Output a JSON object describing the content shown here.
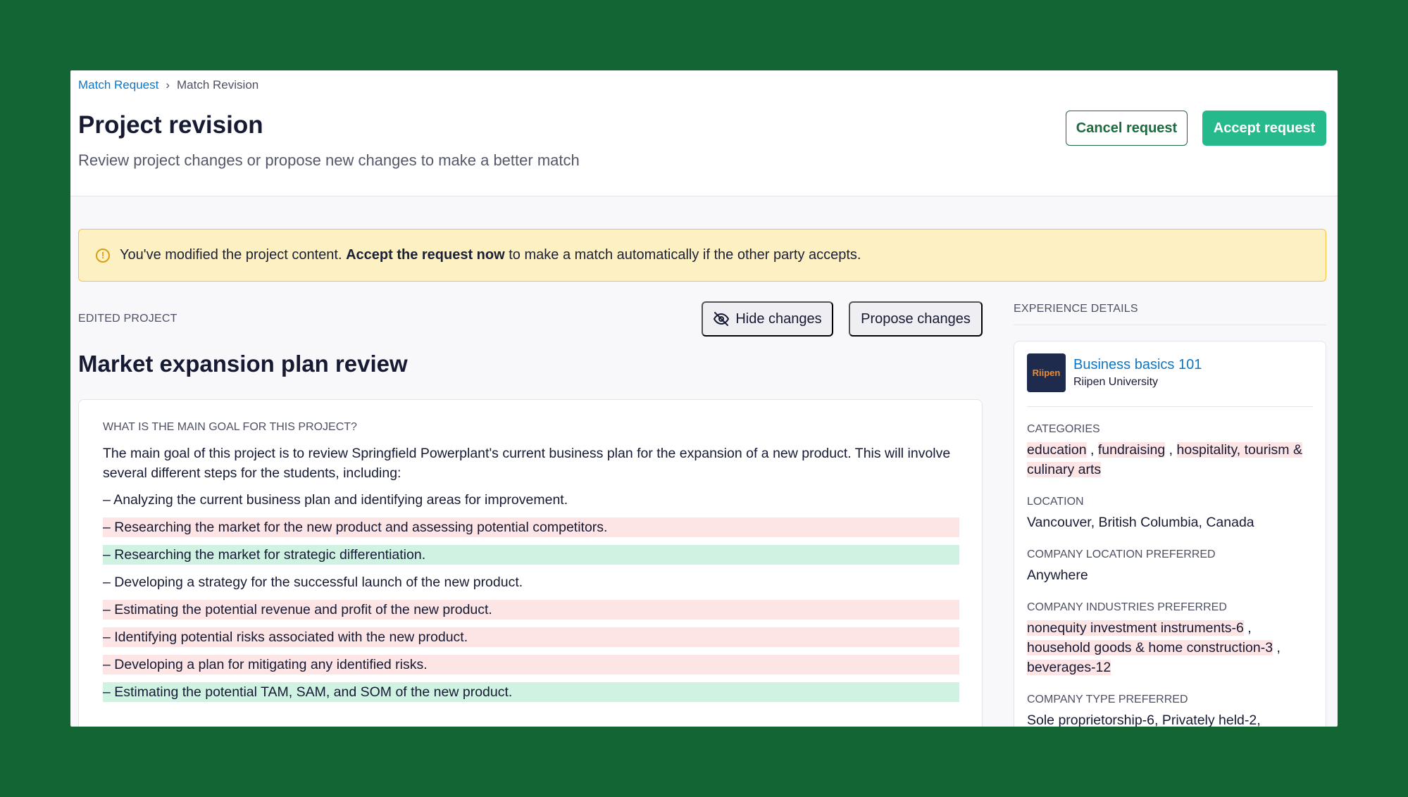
{
  "breadcrumb": {
    "link": "Match Request",
    "separator": "›",
    "current": "Match Revision"
  },
  "header": {
    "title": "Project revision",
    "subtitle": "Review project changes or propose new changes to make a better match",
    "cancel_label": "Cancel request",
    "accept_label": "Accept request"
  },
  "alert": {
    "icon": "info-icon",
    "text_before": "You've modified the project content. ",
    "text_bold": "Accept the request now",
    "text_after": " to make a match automatically if the other party accepts."
  },
  "edited": {
    "label": "EDITED PROJECT",
    "hide_label": "Hide changes",
    "propose_label": "Propose changes",
    "project_title": "Market expansion plan review"
  },
  "goal": {
    "question": "WHAT IS THE MAIN GOAL FOR THIS PROJECT?",
    "intro": "The main goal of this project is to review Springfield Powerplant's current business plan for the expansion of a new product. This will involve several different steps for the students, including:",
    "lines": [
      {
        "text": "– Analyzing the current business plan and identifying areas for improvement.",
        "change": "none"
      },
      {
        "text": "– Researching the market for the new product and assessing potential competitors.",
        "change": "removed"
      },
      {
        "text": "– Researching the market for strategic differentiation.",
        "change": "added"
      },
      {
        "text": "– Developing a strategy for the successful launch of the new product.",
        "change": "none"
      },
      {
        "text": "– Estimating the potential revenue and profit of the new product.",
        "change": "removed"
      },
      {
        "text": "– Identifying potential risks associated with the new product.",
        "change": "removed"
      },
      {
        "text": "– Developing a plan for mitigating any identified risks.",
        "change": "removed"
      },
      {
        "text": "– Estimating the potential TAM, SAM, and SOM of the new product.",
        "change": "added"
      }
    ]
  },
  "experience": {
    "label": "EXPERIENCE DETAILS",
    "logo_text": "Riipen",
    "course_name": "Business basics 101",
    "org_name": "Riipen University",
    "categories_label": "CATEGORIES",
    "categories": [
      "education",
      "fundraising",
      "hospitality, tourism & culinary arts"
    ],
    "location_label": "LOCATION",
    "location": "Vancouver, British Columbia, Canada",
    "company_location_label": "COMPANY LOCATION PREFERRED",
    "company_location": "Anywhere",
    "industries_label": "COMPANY INDUSTRIES PREFERRED",
    "industries": [
      "nonequity investment instruments-6",
      "household goods & home construction-3",
      "beverages-12"
    ],
    "company_type_label": "COMPANY TYPE PREFERRED",
    "company_type": "Sole proprietorship-6, Privately held-2,"
  },
  "colors": {
    "background": "#136534",
    "link": "#0d76c6",
    "accept": "#26b98c",
    "cancel_border": "#1d6a3f",
    "alert_bg": "#fdf0c3",
    "alert_border": "#f1c443",
    "removed_bg": "#fde4e5",
    "added_bg": "#d0f2e3"
  }
}
